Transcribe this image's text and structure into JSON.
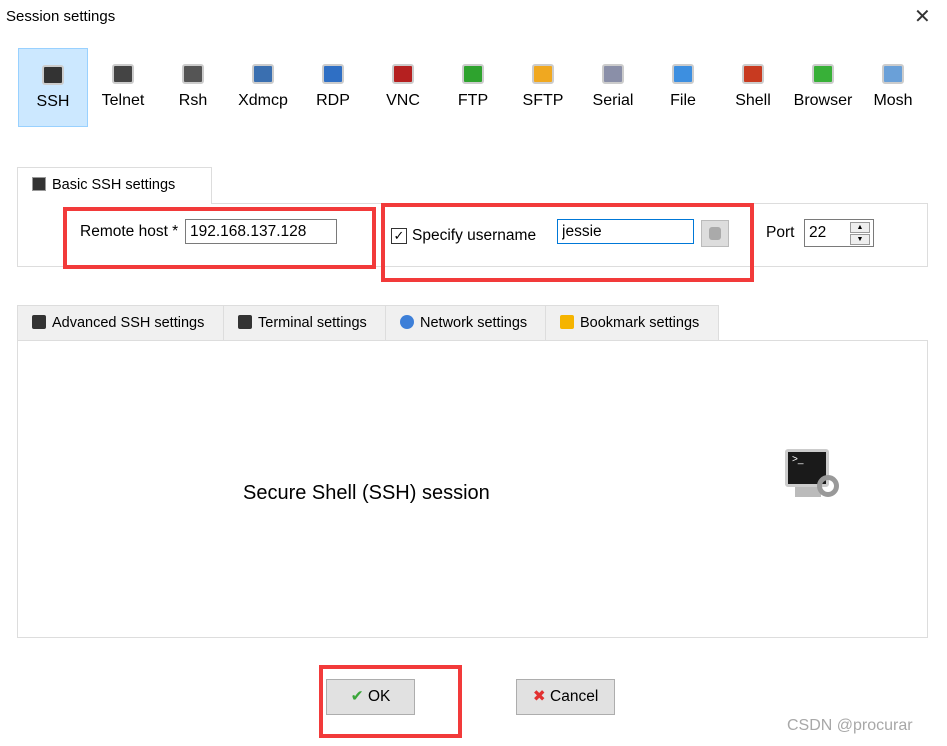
{
  "window": {
    "title": "Session settings",
    "close": "✕"
  },
  "session_types": [
    {
      "label": "SSH",
      "icon": "ssh-icon",
      "color": "#333"
    },
    {
      "label": "Telnet",
      "icon": "telnet-icon",
      "color": "#444"
    },
    {
      "label": "Rsh",
      "icon": "rsh-icon",
      "color": "#555"
    },
    {
      "label": "Xdmcp",
      "icon": "xdmcp-icon",
      "color": "#3a6fb0"
    },
    {
      "label": "RDP",
      "icon": "rdp-icon",
      "color": "#2f6fc4"
    },
    {
      "label": "VNC",
      "icon": "vnc-icon",
      "color": "#b52020"
    },
    {
      "label": "FTP",
      "icon": "ftp-icon",
      "color": "#2ea32e"
    },
    {
      "label": "SFTP",
      "icon": "sftp-icon",
      "color": "#f0a820"
    },
    {
      "label": "Serial",
      "icon": "serial-icon",
      "color": "#8a8fa8"
    },
    {
      "label": "File",
      "icon": "file-icon",
      "color": "#3d8fe0"
    },
    {
      "label": "Shell",
      "icon": "shell-icon",
      "color": "#c83a20"
    },
    {
      "label": "Browser",
      "icon": "browser-icon",
      "color": "#38b038"
    },
    {
      "label": "Mosh",
      "icon": "mosh-icon",
      "color": "#6aa0d8"
    }
  ],
  "selected_session": "SSH",
  "basic_tab": {
    "label": "Basic SSH settings",
    "remote_host_label": "Remote host *",
    "remote_host_value": "192.168.137.128",
    "specify_username_label": "Specify username",
    "specify_username_checked": true,
    "username_value": "jessie",
    "port_label": "Port",
    "port_value": "22"
  },
  "lower_tabs": [
    {
      "label": "Advanced SSH settings",
      "icon": "terminal-icon"
    },
    {
      "label": "Terminal settings",
      "icon": "terminal-settings-icon"
    },
    {
      "label": "Network settings",
      "icon": "network-icon"
    },
    {
      "label": "Bookmark settings",
      "icon": "star-icon"
    }
  ],
  "panel_text": "Secure Shell (SSH) session",
  "buttons": {
    "ok": "OK",
    "cancel": "Cancel"
  },
  "watermark": "CSDN @procurar",
  "annotation_color": "#f23a3a"
}
